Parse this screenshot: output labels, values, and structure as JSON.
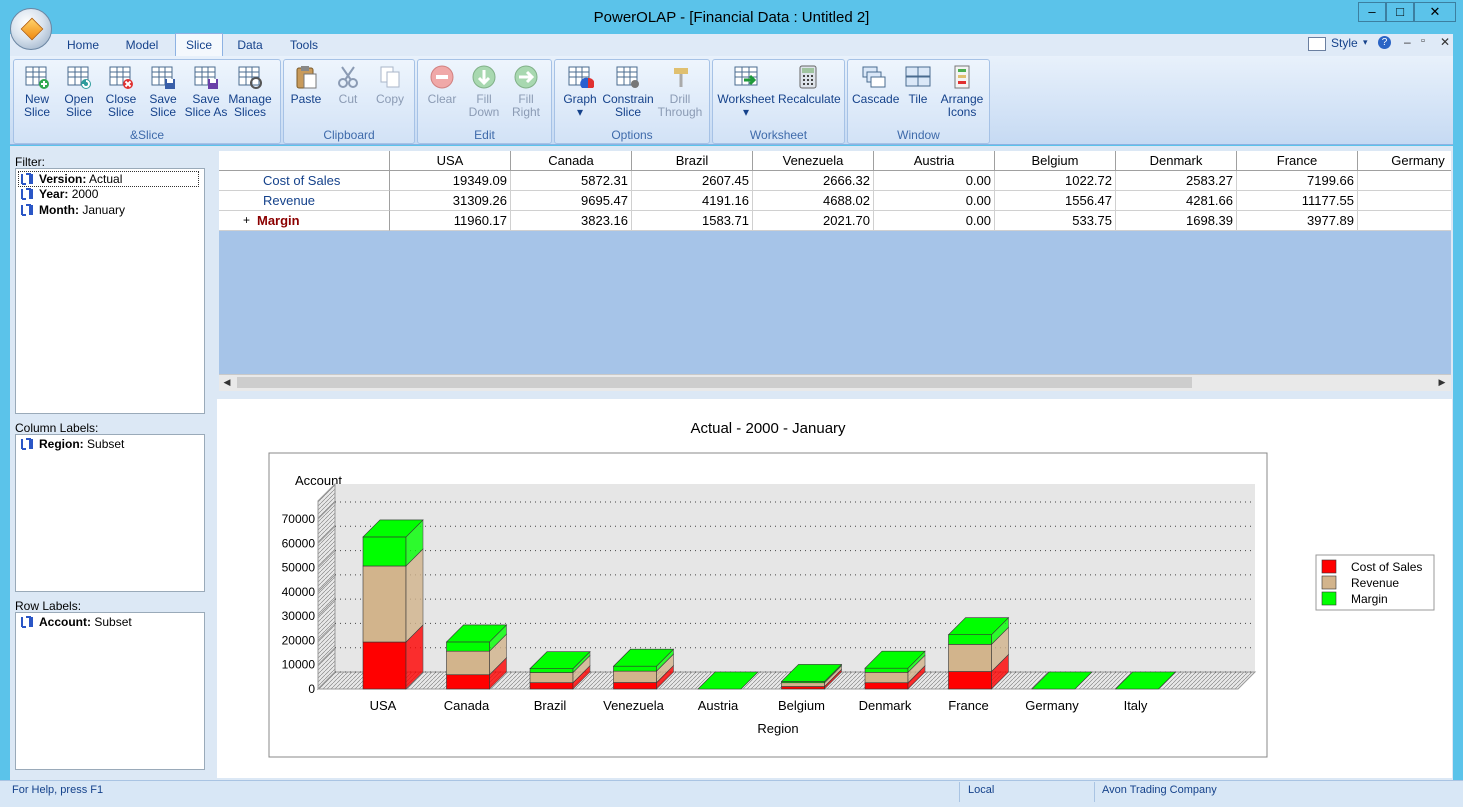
{
  "window": {
    "title": "PowerOLAP - [Financial Data : Untitled 2]",
    "controls": [
      "–",
      "□",
      "✕"
    ]
  },
  "ribbon": {
    "tabs": [
      "Home",
      "Model",
      "Slice",
      "Data",
      "Tools"
    ],
    "active_tab": "Slice",
    "right": {
      "style_label": "Style",
      "help": "?"
    },
    "groups": [
      {
        "label": "&Slice",
        "buttons": [
          {
            "line1": "New",
            "line2": "Slice",
            "icon": "new-slice-icon"
          },
          {
            "line1": "Open",
            "line2": "Slice",
            "icon": "open-slice-icon"
          },
          {
            "line1": "Close",
            "line2": "Slice",
            "icon": "close-slice-icon"
          },
          {
            "line1": "Save",
            "line2": "Slice",
            "icon": "save-slice-icon"
          },
          {
            "line1": "Save",
            "line2": "Slice As",
            "icon": "save-slice-as-icon"
          },
          {
            "line1": "Manage",
            "line2": "Slices",
            "icon": "manage-slices-icon"
          }
        ]
      },
      {
        "label": "Clipboard",
        "buttons": [
          {
            "line1": "Paste",
            "line2": "",
            "icon": "paste-icon"
          },
          {
            "line1": "Cut",
            "line2": "",
            "icon": "cut-icon"
          },
          {
            "line1": "Copy",
            "line2": "",
            "icon": "copy-icon"
          }
        ]
      },
      {
        "label": "Edit",
        "buttons": [
          {
            "line1": "Clear",
            "line2": "",
            "icon": "clear-icon"
          },
          {
            "line1": "Fill",
            "line2": "Down",
            "icon": "fill-down-icon"
          },
          {
            "line1": "Fill",
            "line2": "Right",
            "icon": "fill-right-icon"
          }
        ]
      },
      {
        "label": "Options",
        "buttons": [
          {
            "line1": "Graph",
            "line2": "▾",
            "icon": "graph-icon"
          },
          {
            "line1": "Constrain",
            "line2": "Slice",
            "icon": "constrain-slice-icon"
          },
          {
            "line1": "Drill",
            "line2": "Through",
            "icon": "drill-through-icon"
          }
        ]
      },
      {
        "label": "Worksheet",
        "buttons": [
          {
            "line1": "Worksheet",
            "line2": "▾",
            "icon": "worksheet-icon"
          },
          {
            "line1": "Recalculate",
            "line2": "",
            "icon": "recalculate-icon"
          }
        ]
      },
      {
        "label": "Window",
        "buttons": [
          {
            "line1": "Cascade",
            "line2": "",
            "icon": "cascade-icon"
          },
          {
            "line1": "Tile",
            "line2": "",
            "icon": "tile-icon"
          },
          {
            "line1": "Arrange",
            "line2": "Icons",
            "icon": "arrange-icons-icon"
          }
        ]
      }
    ]
  },
  "left_panel": {
    "filter_label": "Filter:",
    "filters": [
      {
        "dim": "Version:",
        "value": "Actual"
      },
      {
        "dim": "Year:",
        "value": "2000"
      },
      {
        "dim": "Month:",
        "value": "January"
      }
    ],
    "column_label": "Column Labels:",
    "columns": [
      {
        "dim": "Region:",
        "value": "Subset"
      }
    ],
    "row_label": "Row Labels:",
    "rows": [
      {
        "dim": "Account:",
        "value": "Subset"
      }
    ]
  },
  "grid": {
    "columns": [
      "USA",
      "Canada",
      "Brazil",
      "Venezuela",
      "Austria",
      "Belgium",
      "Denmark",
      "France",
      "Germany"
    ],
    "rows": [
      {
        "label": "Cost of Sales",
        "values": [
          "19349.09",
          "5872.31",
          "2607.45",
          "2666.32",
          "0.00",
          "1022.72",
          "2583.27",
          "7199.66",
          "3"
        ]
      },
      {
        "label": "Revenue",
        "values": [
          "31309.26",
          "9695.47",
          "4191.16",
          "4688.02",
          "0.00",
          "1556.47",
          "4281.66",
          "11177.55",
          "4"
        ]
      },
      {
        "label": "Margin",
        "expander": "+",
        "values": [
          "11960.17",
          "3823.16",
          "1583.71",
          "2021.70",
          "0.00",
          "533.75",
          "1698.39",
          "3977.89",
          "1"
        ]
      }
    ]
  },
  "chart_data": {
    "type": "bar",
    "stacked": true,
    "three_d": true,
    "title": "Actual - 2000 - January",
    "xlabel": "Region",
    "ylabel": "Account",
    "categories": [
      "USA",
      "Canada",
      "Brazil",
      "Venezuela",
      "Austria",
      "Belgium",
      "Denmark",
      "France",
      "Germany",
      "Italy"
    ],
    "series": [
      {
        "name": "Cost of Sales",
        "color": "#ff0000",
        "values": [
          19349.09,
          5872.31,
          2607.45,
          2666.32,
          0,
          1022.72,
          2583.27,
          7199.66,
          0,
          0
        ]
      },
      {
        "name": "Revenue",
        "color": "#d2b48c",
        "values": [
          31309.26,
          9695.47,
          4191.16,
          4688.02,
          0,
          1556.47,
          4281.66,
          11177.55,
          0,
          0
        ]
      },
      {
        "name": "Margin",
        "color": "#00ff00",
        "values": [
          11960.17,
          3823.16,
          1583.71,
          2021.7,
          0,
          533.75,
          1698.39,
          3977.89,
          0,
          0
        ]
      }
    ],
    "yticks": [
      "0",
      "10000",
      "20000",
      "30000",
      "40000",
      "50000",
      "60000",
      "70000"
    ],
    "ylim": [
      0,
      70000
    ],
    "grid": true,
    "legend_position": "right"
  },
  "status": {
    "help": "For Help, press F1",
    "mode": "Local",
    "company": "Avon Trading Company"
  }
}
